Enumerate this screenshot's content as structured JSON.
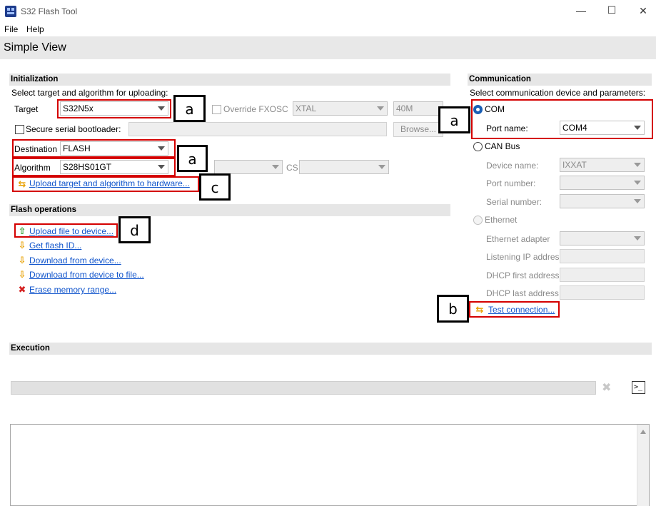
{
  "window": {
    "title": "S32 Flash Tool",
    "controls": {
      "minimize": "—",
      "maximize": "☐",
      "close": "✕"
    }
  },
  "menu": {
    "items": [
      "File",
      "Help"
    ]
  },
  "view_title": "Simple View",
  "initialization": {
    "section_title": "Initialization",
    "instruction": "Select target and algorithm for uploading:",
    "target_label": "Target",
    "target_value": "S32N5x",
    "override_fxosc_label": "Override FXOSC",
    "xtal_value": "XTAL",
    "freq_value": "40M",
    "secure_boot_label": "Secure serial bootloader:",
    "browse_label": "Browse...",
    "destination_label": "Destination",
    "destination_value": "FLASH",
    "algorithm_label": "Algorithm",
    "algorithm_value": "S28HS01GT",
    "cs_label": "CS",
    "upload_target_link": "Upload target and algorithm to hardware..."
  },
  "flash_operations": {
    "section_title": "Flash operations",
    "items": [
      {
        "label": "Upload file to device...",
        "icon": "upload-arrow-icon",
        "color": "#2e9e2e"
      },
      {
        "label": "Get flash ID...",
        "icon": "download-arrow-icon",
        "color": "#e8a000"
      },
      {
        "label": "Download from device...",
        "icon": "download-arrow-icon",
        "color": "#e8a000"
      },
      {
        "label": "Download from device to file...",
        "icon": "download-arrow-icon",
        "color": "#e8a000"
      },
      {
        "label": "Erase memory range...",
        "icon": "erase-x-icon",
        "color": "#d42020"
      }
    ]
  },
  "communication": {
    "section_title": "Communication",
    "instruction": "Select communication device and parameters:",
    "com_label": "COM",
    "port_name_label": "Port name:",
    "port_name_value": "COM4",
    "can_bus_label": "CAN Bus",
    "device_name_label": "Device name:",
    "device_name_value": "IXXAT",
    "port_number_label": "Port number:",
    "serial_number_label": "Serial number:",
    "ethernet_label": "Ethernet",
    "ethernet_adapter_label": "Ethernet adapter",
    "listening_ip_label": "Listening IP addres",
    "dhcp_first_label": "DHCP first address",
    "dhcp_last_label": "DHCP last address",
    "test_connection_link": "Test connection..."
  },
  "execution": {
    "section_title": "Execution",
    "terminal_icon": ">_",
    "cancel_icon": "✖"
  },
  "callouts": {
    "target": "a",
    "com": "a",
    "dest_alg": "a",
    "upload_target": "c",
    "upload_file": "d",
    "test_connection": "b"
  },
  "colors": {
    "accent_red": "#d40000",
    "link_blue": "#1155cc",
    "radio_selected": "#1a5fb4"
  }
}
